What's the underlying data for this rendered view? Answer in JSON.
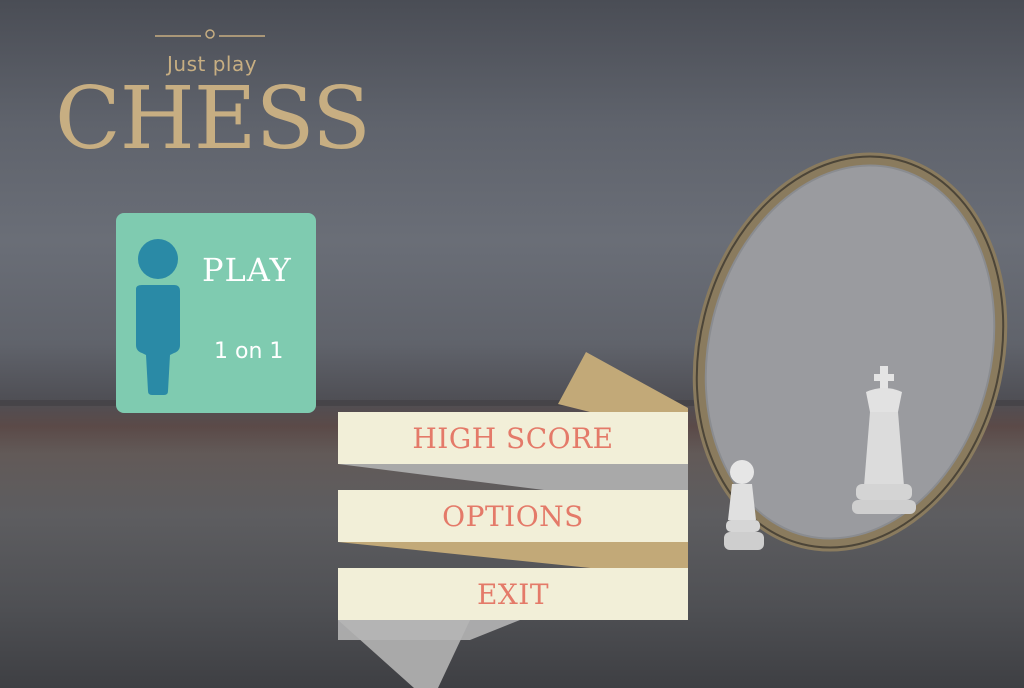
{
  "brand": {
    "tagline": "Just play",
    "title": "CHESS"
  },
  "play_card": {
    "label": "PLAY",
    "mode": "1 on 1",
    "icon": "person-icon"
  },
  "menu": {
    "high_score": "HIGH SCORE",
    "options": "OPTIONS",
    "exit": "EXIT"
  },
  "colors": {
    "gold": "#c7ae82",
    "teal_card": "#7fcbb0",
    "person": "#2a8aa6",
    "ribbon": "#f2efd8",
    "ribbon_text": "#e47a69",
    "ribbon_tail_gold": "#c2a978",
    "ribbon_tail_gray": "#a9a9a9"
  }
}
